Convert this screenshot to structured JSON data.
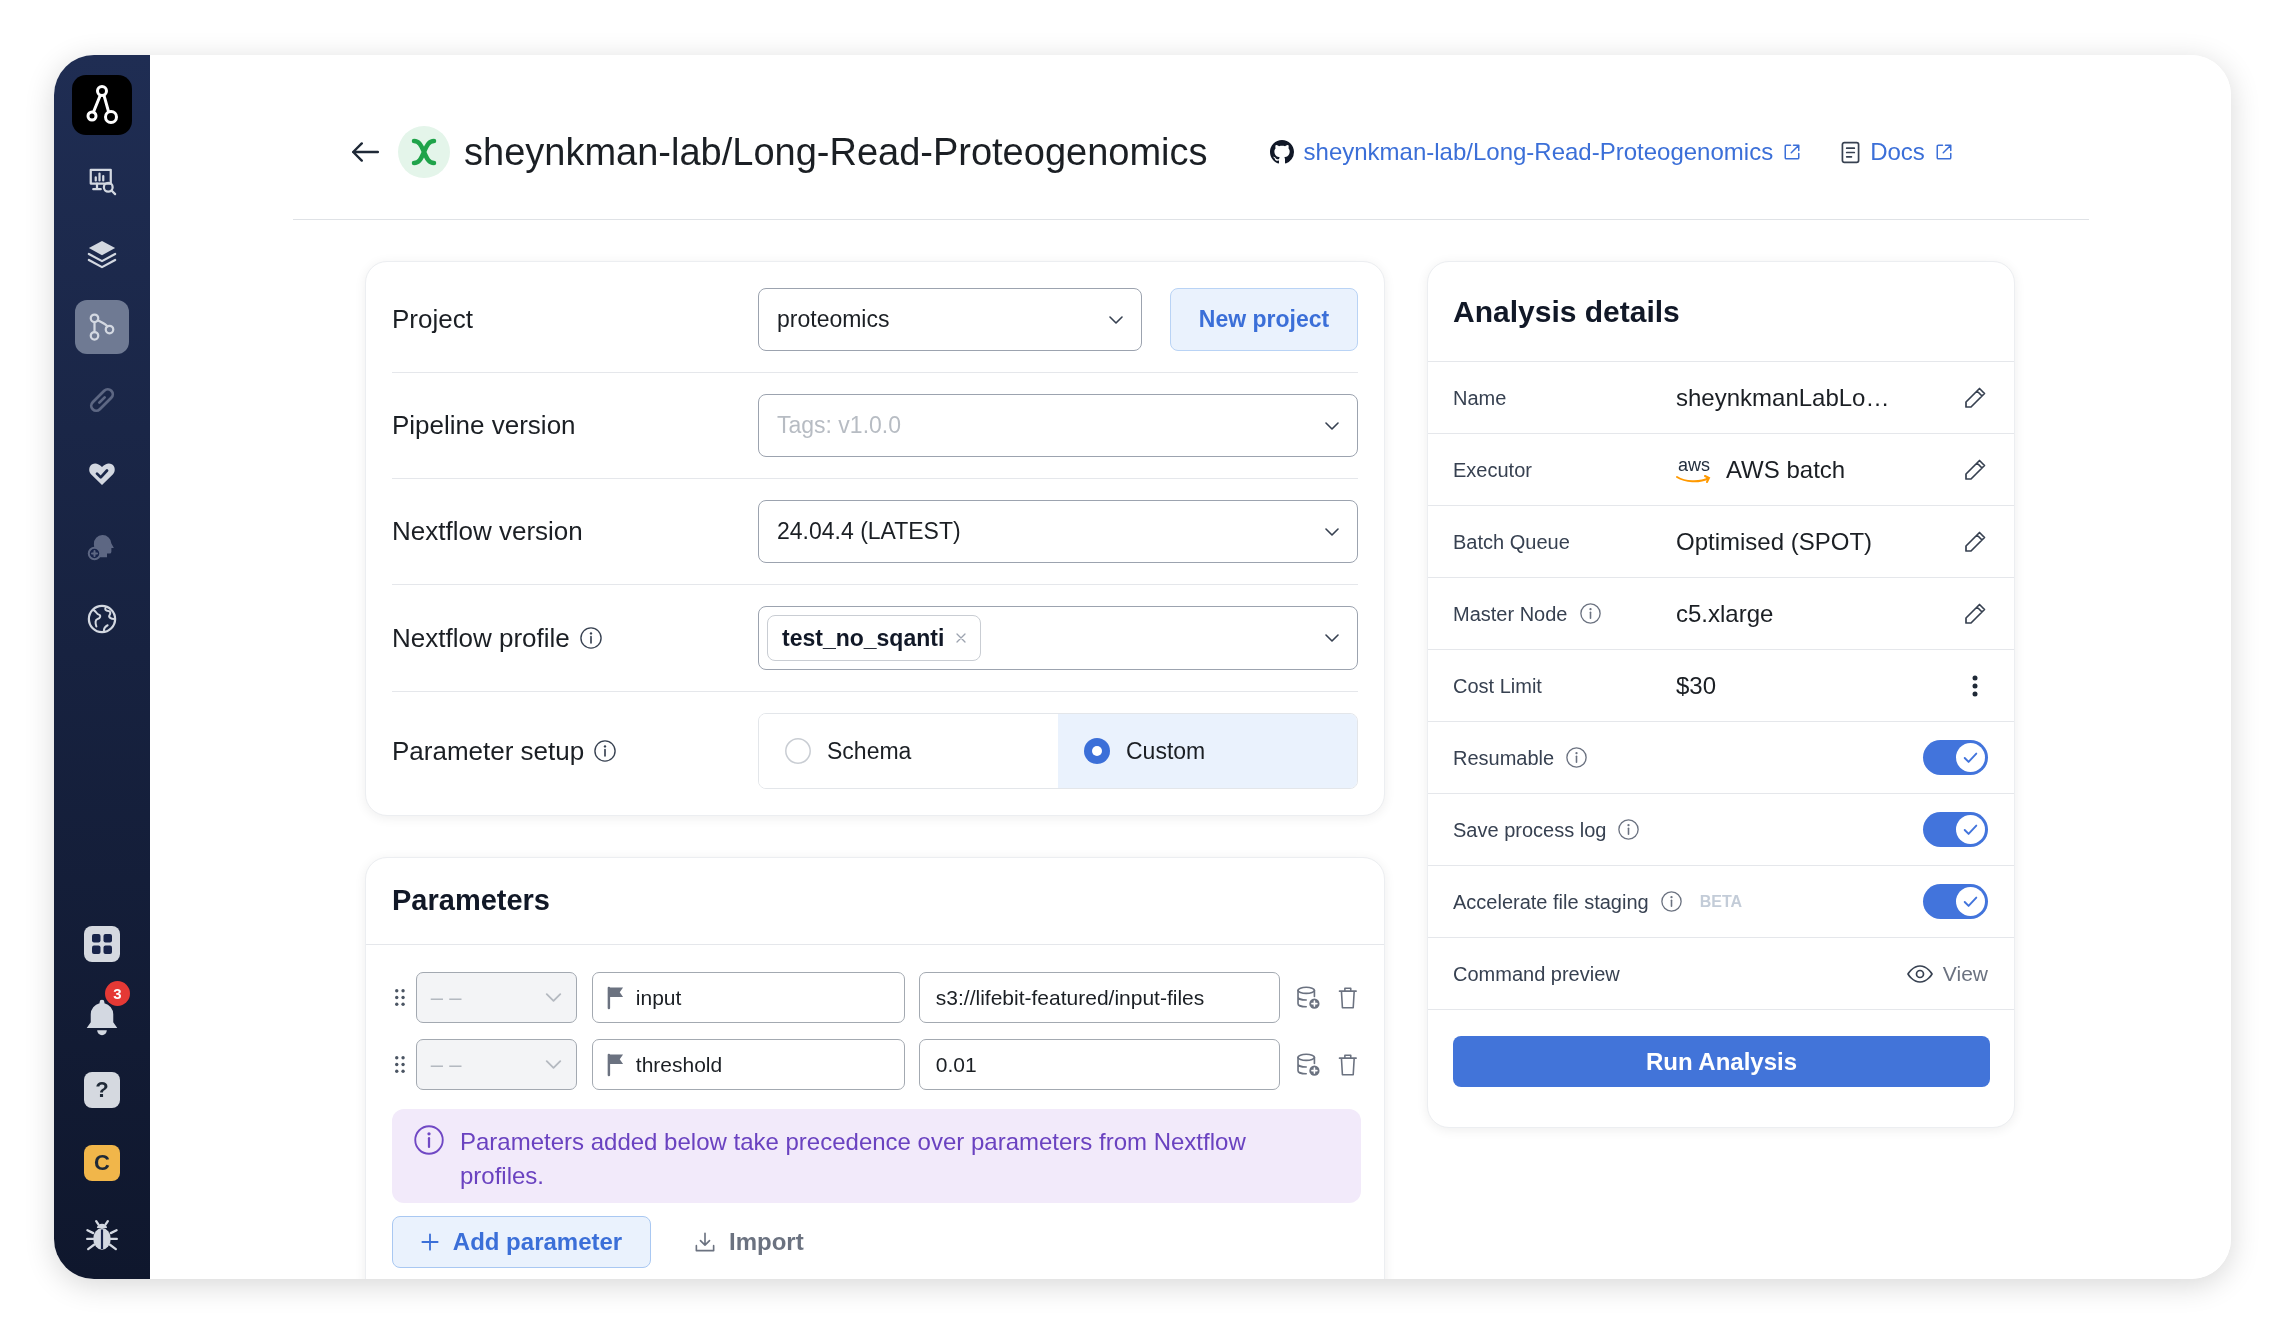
{
  "sidebar": {
    "items": [
      {
        "selected": false,
        "disabled": false
      },
      {
        "selected": false,
        "disabled": false
      },
      {
        "selected": true,
        "disabled": false
      },
      {
        "selected": false,
        "disabled": true
      },
      {
        "selected": false,
        "disabled": false
      },
      {
        "selected": false,
        "disabled": true
      },
      {
        "selected": false,
        "disabled": false
      }
    ],
    "notifications": {
      "badge": "3"
    },
    "help": {
      "label": "?"
    },
    "avatar": {
      "initial": "C"
    }
  },
  "header": {
    "title": "sheynkman-lab/Long-Read-Proteogenomics",
    "links": [
      {
        "kind": "repository",
        "label": "sheynkman-lab/Long-Read-Proteogenomics"
      },
      {
        "kind": "docs",
        "label": "Docs"
      }
    ]
  },
  "setup": {
    "rows": [
      {
        "kind": "select",
        "label": "Project",
        "info": false,
        "value": "proteomics",
        "button": "New project"
      },
      {
        "kind": "select",
        "label": "Pipeline version",
        "info": false,
        "placeholder": "Tags: v1.0.0"
      },
      {
        "kind": "select",
        "label": "Nextflow version",
        "info": false,
        "value": "24.04.4 (LATEST)"
      },
      {
        "kind": "tags",
        "label": "Nextflow profile",
        "info": true,
        "tags": [
          "test_no_sqanti"
        ]
      },
      {
        "kind": "radio",
        "label": "Parameter setup",
        "info": true,
        "options": [
          {
            "label": "Schema",
            "selected": false
          },
          {
            "label": "Custom",
            "selected": true
          }
        ]
      }
    ]
  },
  "parameters": {
    "title": "Parameters",
    "rows": [
      {
        "type_placeholder": "– –",
        "name": "input",
        "value": "s3://lifebit-featured/input-files"
      },
      {
        "type_placeholder": "– –",
        "name": "threshold",
        "value": "0.01"
      }
    ],
    "notice": "Parameters added below take precedence over parameters from Nextflow profiles.",
    "add_button": "Add parameter",
    "import_button": "Import"
  },
  "analysis": {
    "title": "Analysis details",
    "rows": [
      {
        "kind": "edit",
        "label": "Name",
        "info": false,
        "value": "sheynkmanLabLo…"
      },
      {
        "kind": "edit",
        "label": "Executor",
        "info": false,
        "logo": "aws",
        "value": "AWS batch"
      },
      {
        "kind": "edit",
        "label": "Batch Queue",
        "info": false,
        "value": "Optimised (SPOT)"
      },
      {
        "kind": "edit",
        "label": "Master Node",
        "info": true,
        "value": "c5.xlarge"
      },
      {
        "kind": "menu",
        "label": "Cost Limit",
        "info": false,
        "value": "$30"
      },
      {
        "kind": "toggle",
        "label": "Resumable",
        "info": true,
        "on": true
      },
      {
        "kind": "toggle",
        "label": "Save process log",
        "info": true,
        "on": true
      },
      {
        "kind": "toggle",
        "label": "Accelerate file staging",
        "info": true,
        "badge": "BETA",
        "on": true
      },
      {
        "kind": "link",
        "label": "Command preview",
        "info": false,
        "action": "View"
      }
    ],
    "run_button": "Run Analysis"
  }
}
